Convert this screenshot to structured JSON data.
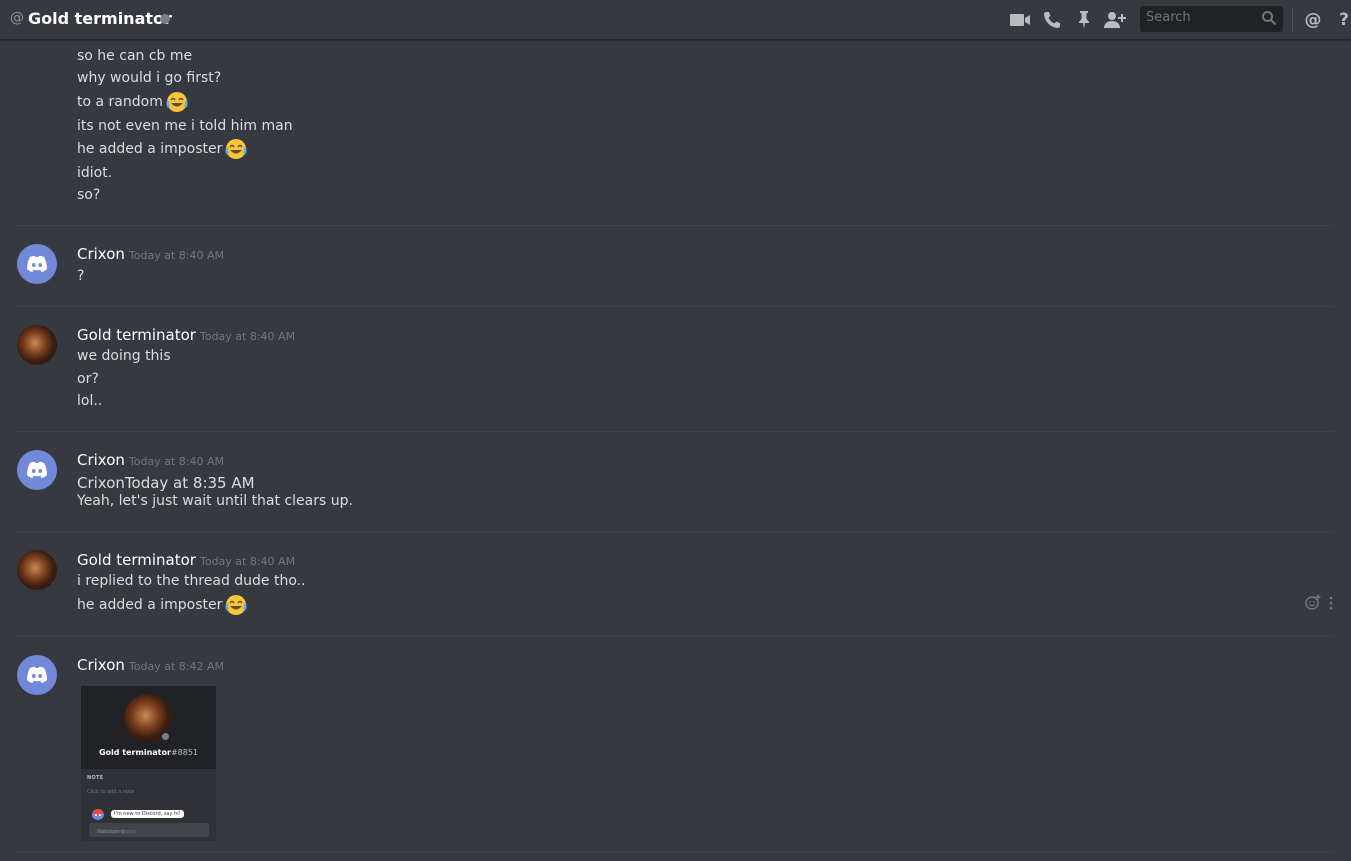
{
  "header": {
    "at_symbol": "@",
    "title": "Gold terminator",
    "icons": [
      "video-call-icon",
      "voice-call-icon",
      "pin-icon",
      "add-friend-icon",
      "mention-icon",
      "help-icon"
    ],
    "search_placeholder": "Search",
    "mention_label": "@",
    "help_label": "?"
  },
  "messages": {
    "block0": {
      "lines": [
        "so he can cb me",
        "why would i go first?",
        "to a random",
        "its not even me i told him man",
        "he added a imposter",
        "idiot.",
        "so?"
      ]
    },
    "block1": {
      "username": "Crixon",
      "timestamp": "Today at 8:40 AM",
      "lines": [
        "?"
      ]
    },
    "block2": {
      "username": "Gold terminator",
      "timestamp": "Today at 8:40 AM",
      "lines": [
        "we doing this",
        "or?",
        "lol.."
      ]
    },
    "block3": {
      "username": "Crixon",
      "timestamp": "Today at 8:40 AM",
      "lines": [
        "CrixonToday at 8:35 AM",
        "Yeah, let's just wait until that clears up."
      ]
    },
    "block4": {
      "username": "Gold terminator",
      "timestamp": "Today at 8:40 AM",
      "lines": [
        "i replied to the thread dude tho..",
        "he added a imposter"
      ]
    },
    "block5": {
      "username": "Crixon",
      "timestamp": "Today at 8:42 AM"
    }
  },
  "embed_card": {
    "name": "Gold terminator",
    "tag": "#8851",
    "note_heading": "NOTE",
    "note_placeholder": "Click to add a note",
    "wumpus_bubble": "I'm new to Discord, say hi!",
    "message_placeholder_prefix": "Message @",
    "message_placeholder_name": "Gold terminator"
  },
  "colors": {
    "background": "#36393f",
    "header_text": "#ffffff",
    "message_text": "#dcddde",
    "timestamp": "#72767d",
    "blurple": "#7289da",
    "search_bg": "#202225"
  }
}
